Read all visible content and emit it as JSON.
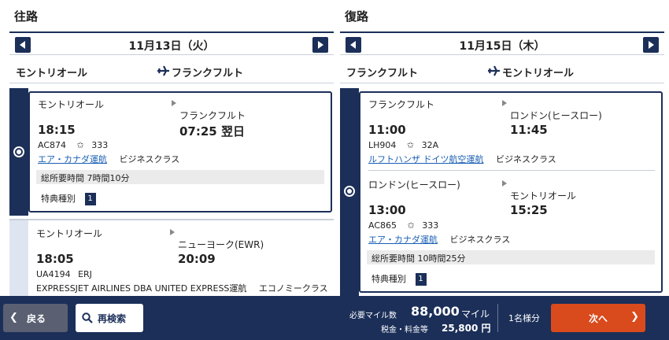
{
  "outbound": {
    "title": "往路",
    "date": "11月13日（火）",
    "from": "モントリオール",
    "to": "フランクフルト",
    "options": [
      {
        "selected": true,
        "segments": [
          {
            "dep_city": "モントリオール",
            "arr_city": "フランクフルト",
            "dep_time": "18:15",
            "arr_time": "07:25 翌日",
            "flight": "AC874",
            "aircraft": "333",
            "operator": "エア・カナダ運航",
            "cabin": "ビジネスクラス"
          }
        ],
        "total": "総所要時間 7時間10分",
        "award_label": "特典種別",
        "award_badge": "1"
      },
      {
        "selected": false,
        "segments": [
          {
            "dep_city": "モントリオール",
            "arr_city": "ニューヨーク(EWR)",
            "dep_time": "18:05",
            "arr_time": "20:09",
            "flight": "UA4194",
            "aircraft": "ERJ",
            "operator": "EXPRESSJET AIRLINES DBA UNITED EXPRESS運航",
            "cabin": "エコノミークラス"
          }
        ]
      }
    ]
  },
  "inbound": {
    "title": "復路",
    "date": "11月15日（木）",
    "from": "フランクフルト",
    "to": "モントリオール",
    "options": [
      {
        "selected": true,
        "segments": [
          {
            "dep_city": "フランクフルト",
            "arr_city": "ロンドン(ヒースロー)",
            "dep_time": "11:00",
            "arr_time": "11:45",
            "flight": "LH904",
            "aircraft": "32A",
            "operator": "ルフトハンザ ドイツ航空運航",
            "cabin": "ビジネスクラス"
          },
          {
            "dep_city": "ロンドン(ヒースロー)",
            "arr_city": "モントリオール",
            "dep_time": "13:00",
            "arr_time": "15:25",
            "flight": "AC865",
            "aircraft": "333",
            "operator": "エア・カナダ運航",
            "cabin": "ビジネスクラス"
          }
        ],
        "total": "総所要時間 10時間25分",
        "award_label": "特典種別",
        "award_badge": "1"
      }
    ]
  },
  "footer": {
    "back_label": "戻る",
    "research_label": "再検索",
    "miles_label": "必要マイル数",
    "miles_value": "88,000",
    "miles_unit": "マイル",
    "tax_label": "税金・料金等",
    "tax_value": "25,800 円",
    "pax_label": "1名様分",
    "next_label": "次へ"
  },
  "icons": {
    "prev": "chevron-left-icon",
    "next": "chevron-right-icon",
    "plane": "airplane-icon",
    "alliance": "star-alliance-icon",
    "search": "search-icon"
  },
  "colors": {
    "navy": "#1b2f59",
    "next_button": "#d94a1c",
    "link": "#1a5fb4"
  }
}
